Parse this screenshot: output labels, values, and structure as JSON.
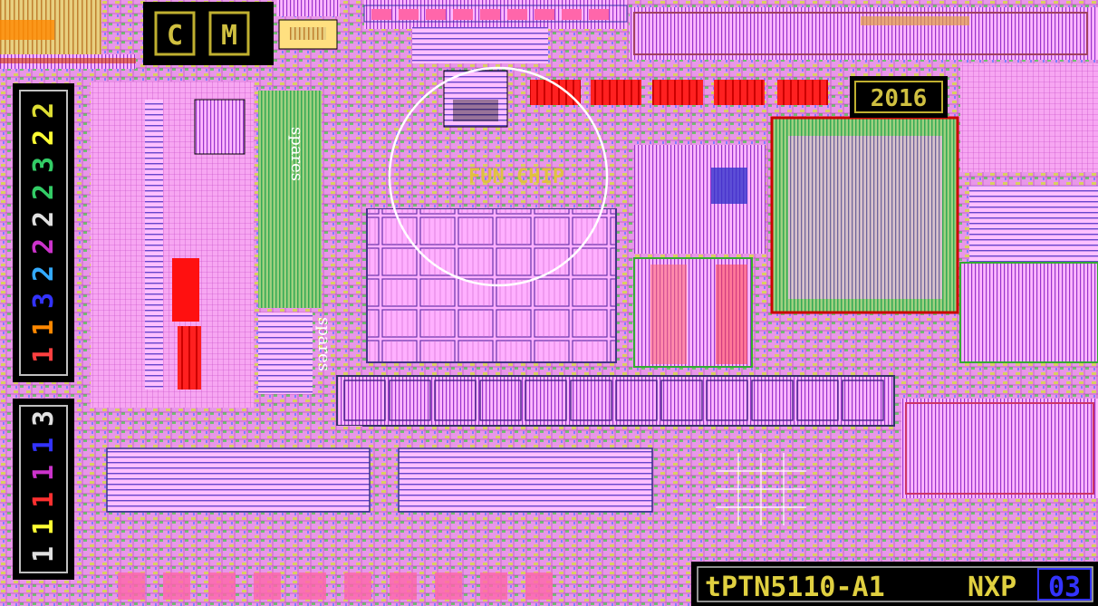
{
  "die": {
    "logo_letters": [
      "C",
      "M"
    ],
    "year": "2016",
    "part_number": "tPTN5110-A1",
    "vendor": "NXP",
    "revision": "03",
    "spares_label_1": "spares",
    "spares_label_2": "spares",
    "chinese_mark": "FUN CHIP",
    "metal_codes_top": [
      "1",
      "1",
      "3",
      "2",
      "2",
      "2",
      "2",
      "3",
      "2",
      "2"
    ],
    "metal_codes_bottom": [
      "1",
      "1",
      "1",
      "1",
      "1",
      "3"
    ]
  },
  "palette": {
    "background": "#ff99ff",
    "metal1": "#ff66cc",
    "metal2": "#cccc33",
    "metal3": "#33cc66",
    "poly": "#ff0000",
    "diffusion": "#6666ff",
    "outline": "#000000",
    "label_yellow": "#ffff33"
  }
}
